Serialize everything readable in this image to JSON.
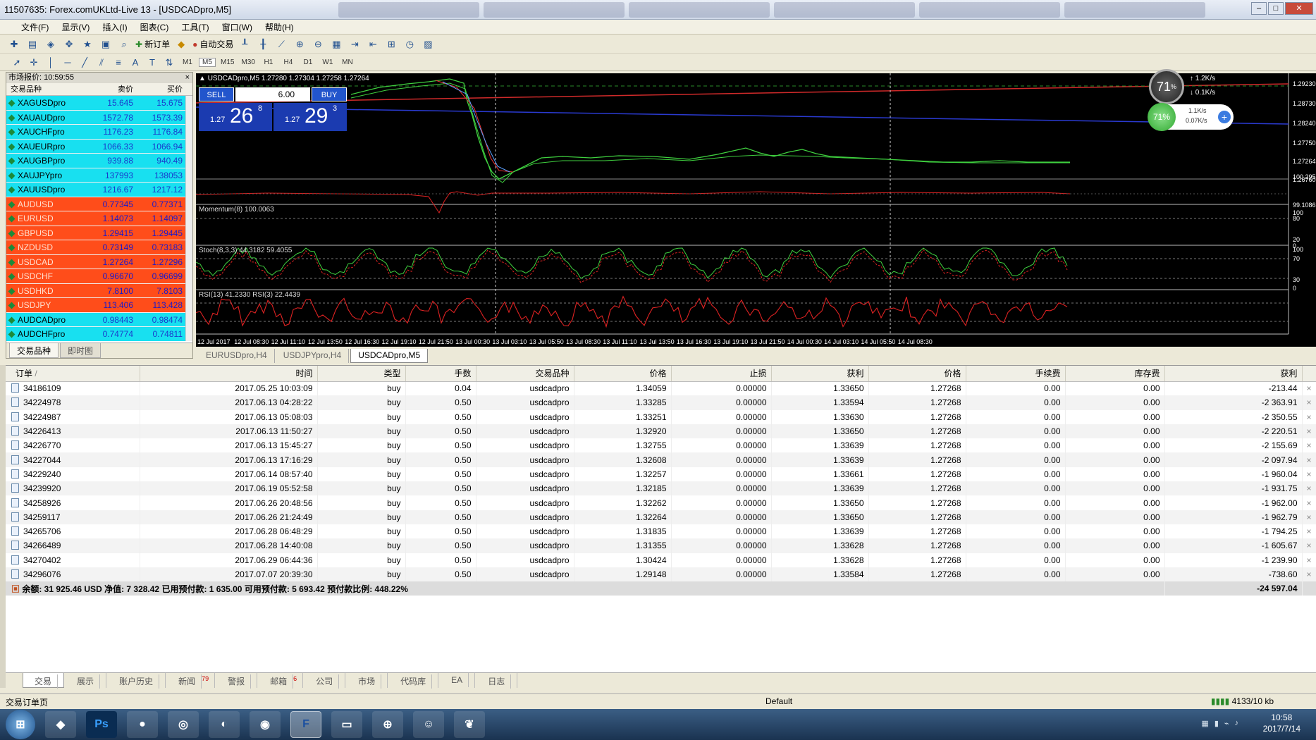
{
  "window": {
    "title": "11507635: Forex.comUKLtd-Live 13 - [USDCADpro,M5]"
  },
  "menu": [
    "文件(F)",
    "显示(V)",
    "插入(I)",
    "图表(C)",
    "工具(T)",
    "窗口(W)",
    "帮助(H)"
  ],
  "toolbar": {
    "new_order": "新订单",
    "auto_trade": "自动交易",
    "timeframes": [
      "M1",
      "M5",
      "M15",
      "M30",
      "H1",
      "H4",
      "D1",
      "W1",
      "MN"
    ]
  },
  "market_watch": {
    "title": "市场报价: 10:59:55",
    "headers": {
      "symbol": "交易品种",
      "bid": "卖价",
      "ask": "买价"
    },
    "rows": [
      {
        "symbol": "XAGUSDpro",
        "bid": "15.645",
        "ask": "15.675",
        "color": "#18e0f0"
      },
      {
        "symbol": "XAUAUDpro",
        "bid": "1572.78",
        "ask": "1573.39",
        "color": "#18e0f0"
      },
      {
        "symbol": "XAUCHFpro",
        "bid": "1176.23",
        "ask": "1176.84",
        "color": "#18e0f0"
      },
      {
        "symbol": "XAUEURpro",
        "bid": "1066.33",
        "ask": "1066.94",
        "color": "#18e0f0"
      },
      {
        "symbol": "XAUGBPpro",
        "bid": "939.88",
        "ask": "940.49",
        "color": "#18e0f0"
      },
      {
        "symbol": "XAUJPYpro",
        "bid": "137993",
        "ask": "138053",
        "color": "#18e0f0"
      },
      {
        "symbol": "XAUUSDpro",
        "bid": "1216.67",
        "ask": "1217.12",
        "color": "#18e0f0"
      },
      {
        "symbol": "AUDUSD",
        "bid": "0.77345",
        "ask": "0.77371",
        "color": "#ff4d1a"
      },
      {
        "symbol": "EURUSD",
        "bid": "1.14073",
        "ask": "1.14097",
        "color": "#ff4d1a"
      },
      {
        "symbol": "GBPUSD",
        "bid": "1.29415",
        "ask": "1.29445",
        "color": "#ff4d1a"
      },
      {
        "symbol": "NZDUSD",
        "bid": "0.73149",
        "ask": "0.73183",
        "color": "#ff4d1a"
      },
      {
        "symbol": "USDCAD",
        "bid": "1.27264",
        "ask": "1.27296",
        "color": "#ff4d1a"
      },
      {
        "symbol": "USDCHF",
        "bid": "0.96670",
        "ask": "0.96699",
        "color": "#ff4d1a"
      },
      {
        "symbol": "USDHKD",
        "bid": "7.8100",
        "ask": "7.8103",
        "color": "#ff4d1a"
      },
      {
        "symbol": "USDJPY",
        "bid": "113.406",
        "ask": "113.428",
        "color": "#ff4d1a"
      },
      {
        "symbol": "AUDCADpro",
        "bid": "0.98443",
        "ask": "0.98474",
        "color": "#18e0f0"
      },
      {
        "symbol": "AUDCHFpro",
        "bid": "0.74774",
        "ask": "0.74811",
        "color": "#18e0f0"
      }
    ],
    "tabs": [
      "交易品种",
      "即时图"
    ]
  },
  "chart": {
    "header": "USDCADpro,M5  1.27280 1.27304 1.27258 1.27264",
    "sell_label": "SELL",
    "buy_label": "BUY",
    "lot": "6.00",
    "sell_price_prefix": "1.27",
    "sell_price_big": "26",
    "sell_price_sup": "8",
    "buy_price_prefix": "1.27",
    "buy_price_big": "29",
    "buy_price_sup": "3",
    "momentum_label": "Momentum(8) 100.0063",
    "stoch_label": "Stoch(8,3,3) 44.3182 59.4055",
    "rsi_label": "RSI(13) 41.2330  RSI(3) 22.4439",
    "price_axis": [
      "1.29230",
      "1.28730",
      "1.28240",
      "1.27750",
      "1.27264",
      "1.26760"
    ],
    "mom_axis": [
      "100.295",
      "99.1086"
    ],
    "stoch_axis": [
      "100",
      "80",
      "20",
      "0"
    ],
    "rsi_axis": [
      "100",
      "70",
      "30",
      "0"
    ],
    "time_axis": [
      "12 Jul 2017",
      "12 Jul 08:30",
      "12 Jul 11:10",
      "12 Jul 13:50",
      "12 Jul 16:30",
      "12 Jul 19:10",
      "12 Jul 21:50",
      "13 Jul 00:30",
      "13 Jul 03:10",
      "13 Jul 05:50",
      "13 Jul 08:30",
      "13 Jul 11:10",
      "13 Jul 13:50",
      "13 Jul 16:30",
      "13 Jul 19:10",
      "13 Jul 21:50",
      "14 Jul 00:30",
      "14 Jul 03:10",
      "14 Jul 05:50",
      "14 Jul 08:30"
    ],
    "widget": {
      "cpu": "71",
      "cpu_unit": "%",
      "net_up": "1.2K/s",
      "net_down": "0.1K/s",
      "mem": "71%",
      "up2": "1.1K/s",
      "down2": "0.07K/s"
    }
  },
  "chart_tabs": [
    "EURUSDpro,H4",
    "USDJPYpro,H4",
    "USDCADpro,M5"
  ],
  "terminal": {
    "headers": [
      "订单",
      "时间",
      "类型",
      "手数",
      "交易品种",
      "价格",
      "止损",
      "获利",
      "价格",
      "手续费",
      "库存费",
      "获利"
    ],
    "sort_mark": "/",
    "rows": [
      [
        "34186109",
        "2017.05.25 10:03:09",
        "buy",
        "0.04",
        "usdcadpro",
        "1.34059",
        "0.00000",
        "1.33650",
        "1.27268",
        "0.00",
        "0.00",
        "-213.44"
      ],
      [
        "34224978",
        "2017.06.13 04:28:22",
        "buy",
        "0.50",
        "usdcadpro",
        "1.33285",
        "0.00000",
        "1.33594",
        "1.27268",
        "0.00",
        "0.00",
        "-2 363.91"
      ],
      [
        "34224987",
        "2017.06.13 05:08:03",
        "buy",
        "0.50",
        "usdcadpro",
        "1.33251",
        "0.00000",
        "1.33630",
        "1.27268",
        "0.00",
        "0.00",
        "-2 350.55"
      ],
      [
        "34226413",
        "2017.06.13 11:50:27",
        "buy",
        "0.50",
        "usdcadpro",
        "1.32920",
        "0.00000",
        "1.33650",
        "1.27268",
        "0.00",
        "0.00",
        "-2 220.51"
      ],
      [
        "34226770",
        "2017.06.13 15:45:27",
        "buy",
        "0.50",
        "usdcadpro",
        "1.32755",
        "0.00000",
        "1.33639",
        "1.27268",
        "0.00",
        "0.00",
        "-2 155.69"
      ],
      [
        "34227044",
        "2017.06.13 17:16:29",
        "buy",
        "0.50",
        "usdcadpro",
        "1.32608",
        "0.00000",
        "1.33639",
        "1.27268",
        "0.00",
        "0.00",
        "-2 097.94"
      ],
      [
        "34229240",
        "2017.06.14 08:57:40",
        "buy",
        "0.50",
        "usdcadpro",
        "1.32257",
        "0.00000",
        "1.33661",
        "1.27268",
        "0.00",
        "0.00",
        "-1 960.04"
      ],
      [
        "34239920",
        "2017.06.19 05:52:58",
        "buy",
        "0.50",
        "usdcadpro",
        "1.32185",
        "0.00000",
        "1.33639",
        "1.27268",
        "0.00",
        "0.00",
        "-1 931.75"
      ],
      [
        "34258926",
        "2017.06.26 20:48:56",
        "buy",
        "0.50",
        "usdcadpro",
        "1.32262",
        "0.00000",
        "1.33650",
        "1.27268",
        "0.00",
        "0.00",
        "-1 962.00"
      ],
      [
        "34259117",
        "2017.06.26 21:24:49",
        "buy",
        "0.50",
        "usdcadpro",
        "1.32264",
        "0.00000",
        "1.33650",
        "1.27268",
        "0.00",
        "0.00",
        "-1 962.79"
      ],
      [
        "34265706",
        "2017.06.28 06:48:29",
        "buy",
        "0.50",
        "usdcadpro",
        "1.31835",
        "0.00000",
        "1.33639",
        "1.27268",
        "0.00",
        "0.00",
        "-1 794.25"
      ],
      [
        "34266489",
        "2017.06.28 14:40:08",
        "buy",
        "0.50",
        "usdcadpro",
        "1.31355",
        "0.00000",
        "1.33628",
        "1.27268",
        "0.00",
        "0.00",
        "-1 605.67"
      ],
      [
        "34270402",
        "2017.06.29 06:44:36",
        "buy",
        "0.50",
        "usdcadpro",
        "1.30424",
        "0.00000",
        "1.33628",
        "1.27268",
        "0.00",
        "0.00",
        "-1 239.90"
      ],
      [
        "34296076",
        "2017.07.07 20:39:30",
        "buy",
        "0.50",
        "usdcadpro",
        "1.29148",
        "0.00000",
        "1.33584",
        "1.27268",
        "0.00",
        "0.00",
        "-738.60"
      ]
    ],
    "summary": "余额: 31 925.46 USD  净值: 7 328.42  已用预付款: 1 635.00  可用预付款: 5 693.42  预付款比例: 448.22%",
    "summary_total": "-24 597.04",
    "tabs": [
      {
        "label": "交易",
        "badge": ""
      },
      {
        "label": "展示",
        "badge": ""
      },
      {
        "label": "账户历史",
        "badge": ""
      },
      {
        "label": "新闻",
        "badge": "79"
      },
      {
        "label": "警报",
        "badge": ""
      },
      {
        "label": "邮箱",
        "badge": "6"
      },
      {
        "label": "公司",
        "badge": ""
      },
      {
        "label": "市场",
        "badge": ""
      },
      {
        "label": "代码库",
        "badge": ""
      },
      {
        "label": "EA",
        "badge": ""
      },
      {
        "label": "日志",
        "badge": ""
      }
    ]
  },
  "status": {
    "left": "交易订单页",
    "profile": "Default",
    "traffic": "4133/10 kb"
  },
  "clock": {
    "time": "10:58",
    "date": "2017/7/14"
  },
  "taskbar_apps": [
    "Ps",
    "F"
  ]
}
